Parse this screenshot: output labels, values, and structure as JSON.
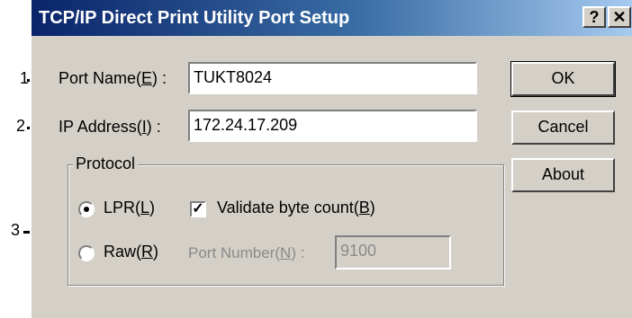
{
  "window": {
    "title": "TCP/IP Direct Print Utility Port Setup",
    "help_glyph": "?",
    "close_glyph": "✕"
  },
  "fields": {
    "port_name": {
      "label_main": "Port Name(",
      "label_mnemonic": "E",
      "label_tail": ") :",
      "value": "TUKT8024"
    },
    "ip_address": {
      "label_main": "IP Address(",
      "label_mnemonic": "I",
      "label_tail": ") :",
      "value": "172.24.17.209"
    }
  },
  "buttons": {
    "ok": "OK",
    "cancel": "Cancel",
    "about": "About"
  },
  "protocol": {
    "group_title": "Protocol",
    "lpr_main": "LPR(",
    "lpr_mnemonic": "L",
    "lpr_tail": ")",
    "raw_main": "Raw(",
    "raw_mnemonic": "R",
    "raw_tail": ")",
    "selected": "LPR",
    "validate_main": "Validate byte count(",
    "validate_mnemonic": "B",
    "validate_tail": ")",
    "validate_checked": true,
    "port_number_main": "Port Number(",
    "port_number_mnemonic": "N",
    "port_number_tail": ") :",
    "port_number_value": "9100"
  },
  "callouts": {
    "c1": "1",
    "c2": "2",
    "c3": "3"
  }
}
